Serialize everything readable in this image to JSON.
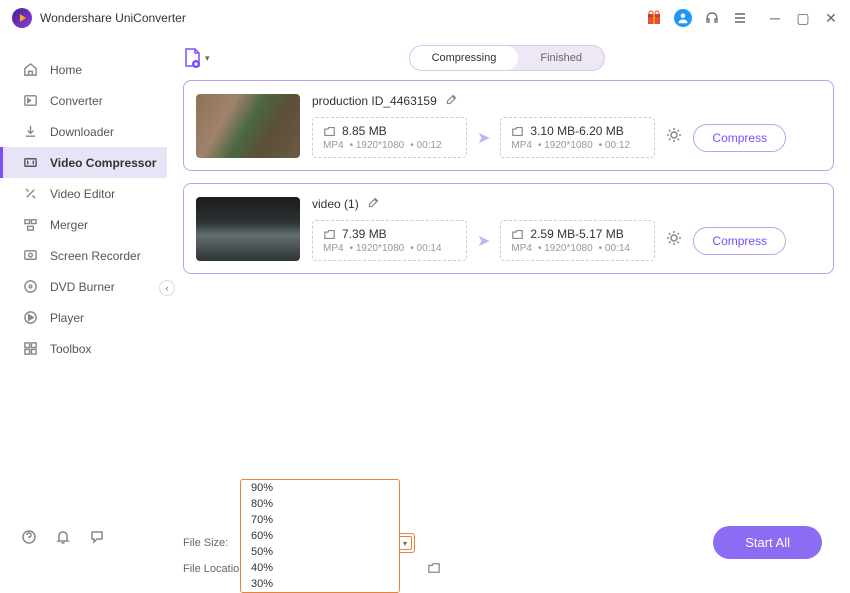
{
  "app": {
    "title": "Wondershare UniConverter"
  },
  "sidebar": {
    "items": [
      {
        "label": "Home"
      },
      {
        "label": "Converter"
      },
      {
        "label": "Downloader"
      },
      {
        "label": "Video Compressor"
      },
      {
        "label": "Video Editor"
      },
      {
        "label": "Merger"
      },
      {
        "label": "Screen Recorder"
      },
      {
        "label": "DVD Burner"
      },
      {
        "label": "Player"
      },
      {
        "label": "Toolbox"
      }
    ]
  },
  "tabs": {
    "compressing": "Compressing",
    "finished": "Finished"
  },
  "files": [
    {
      "name": "production ID_4463159",
      "src": {
        "size": "8.85 MB",
        "format": "MP4",
        "res": "1920*1080",
        "dur": "00:12"
      },
      "dst": {
        "size": "3.10 MB-6.20 MB",
        "format": "MP4",
        "res": "1920*1080",
        "dur": "00:12"
      },
      "btn": "Compress"
    },
    {
      "name": "video (1)",
      "src": {
        "size": "7.39 MB",
        "format": "MP4",
        "res": "1920*1080",
        "dur": "00:14"
      },
      "dst": {
        "size": "2.59 MB-5.17 MB",
        "format": "MP4",
        "res": "1920*1080",
        "dur": "00:14"
      },
      "btn": "Compress"
    }
  ],
  "bottom": {
    "file_size_label": "File Size:",
    "file_size_value": "70%",
    "file_location_label": "File Location:",
    "start_all": "Start All"
  },
  "dropdown": {
    "options": [
      "90%",
      "80%",
      "70%",
      "60%",
      "50%",
      "40%",
      "30%"
    ]
  }
}
